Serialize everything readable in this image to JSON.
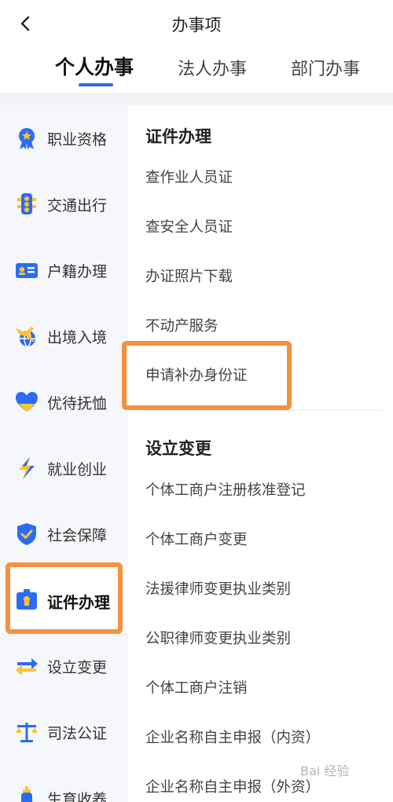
{
  "header": {
    "title": "办事项",
    "back_icon": "chevron-left-icon"
  },
  "tabs": [
    {
      "label": "个人办事",
      "active": true
    },
    {
      "label": "法人办事",
      "active": false
    },
    {
      "label": "部门办事",
      "active": false
    }
  ],
  "colors": {
    "accent": "#2b6cf6",
    "highlight": "#f3913e",
    "sidebar_bg": "#f5f7fa"
  },
  "sidebar": {
    "items": [
      {
        "label": "职业资格",
        "icon": "medal-icon"
      },
      {
        "label": "交通出行",
        "icon": "traffic-light-icon"
      },
      {
        "label": "户籍办理",
        "icon": "id-card-icon"
      },
      {
        "label": "出境入境",
        "icon": "globe-plane-icon"
      },
      {
        "label": "优待抚恤",
        "icon": "heart-icon"
      },
      {
        "label": "就业创业",
        "icon": "lightning-icon"
      },
      {
        "label": "社会保障",
        "icon": "shield-check-icon"
      },
      {
        "label": "证件办理",
        "icon": "certificate-icon",
        "active": true
      },
      {
        "label": "设立变更",
        "icon": "swap-arrows-icon"
      },
      {
        "label": "司法公证",
        "icon": "scales-icon"
      },
      {
        "label": "生育收养",
        "icon": "baby-bottle-icon"
      }
    ]
  },
  "content": {
    "sections": [
      {
        "title": "证件办理",
        "items": [
          "查作业人员证",
          "查安全人员证",
          "办证照片下载",
          "不动产服务",
          "申请补办身份证"
        ]
      },
      {
        "title": "设立变更",
        "items": [
          "个体工商户注册核准登记",
          "个体工商户变更",
          "法援律师变更执业类别",
          "公职律师变更执业类别",
          "个体工商户注销",
          "企业名称自主申报（内资）",
          "企业名称自主申报（外资）"
        ]
      }
    ]
  },
  "watermark": "Bai 经验"
}
